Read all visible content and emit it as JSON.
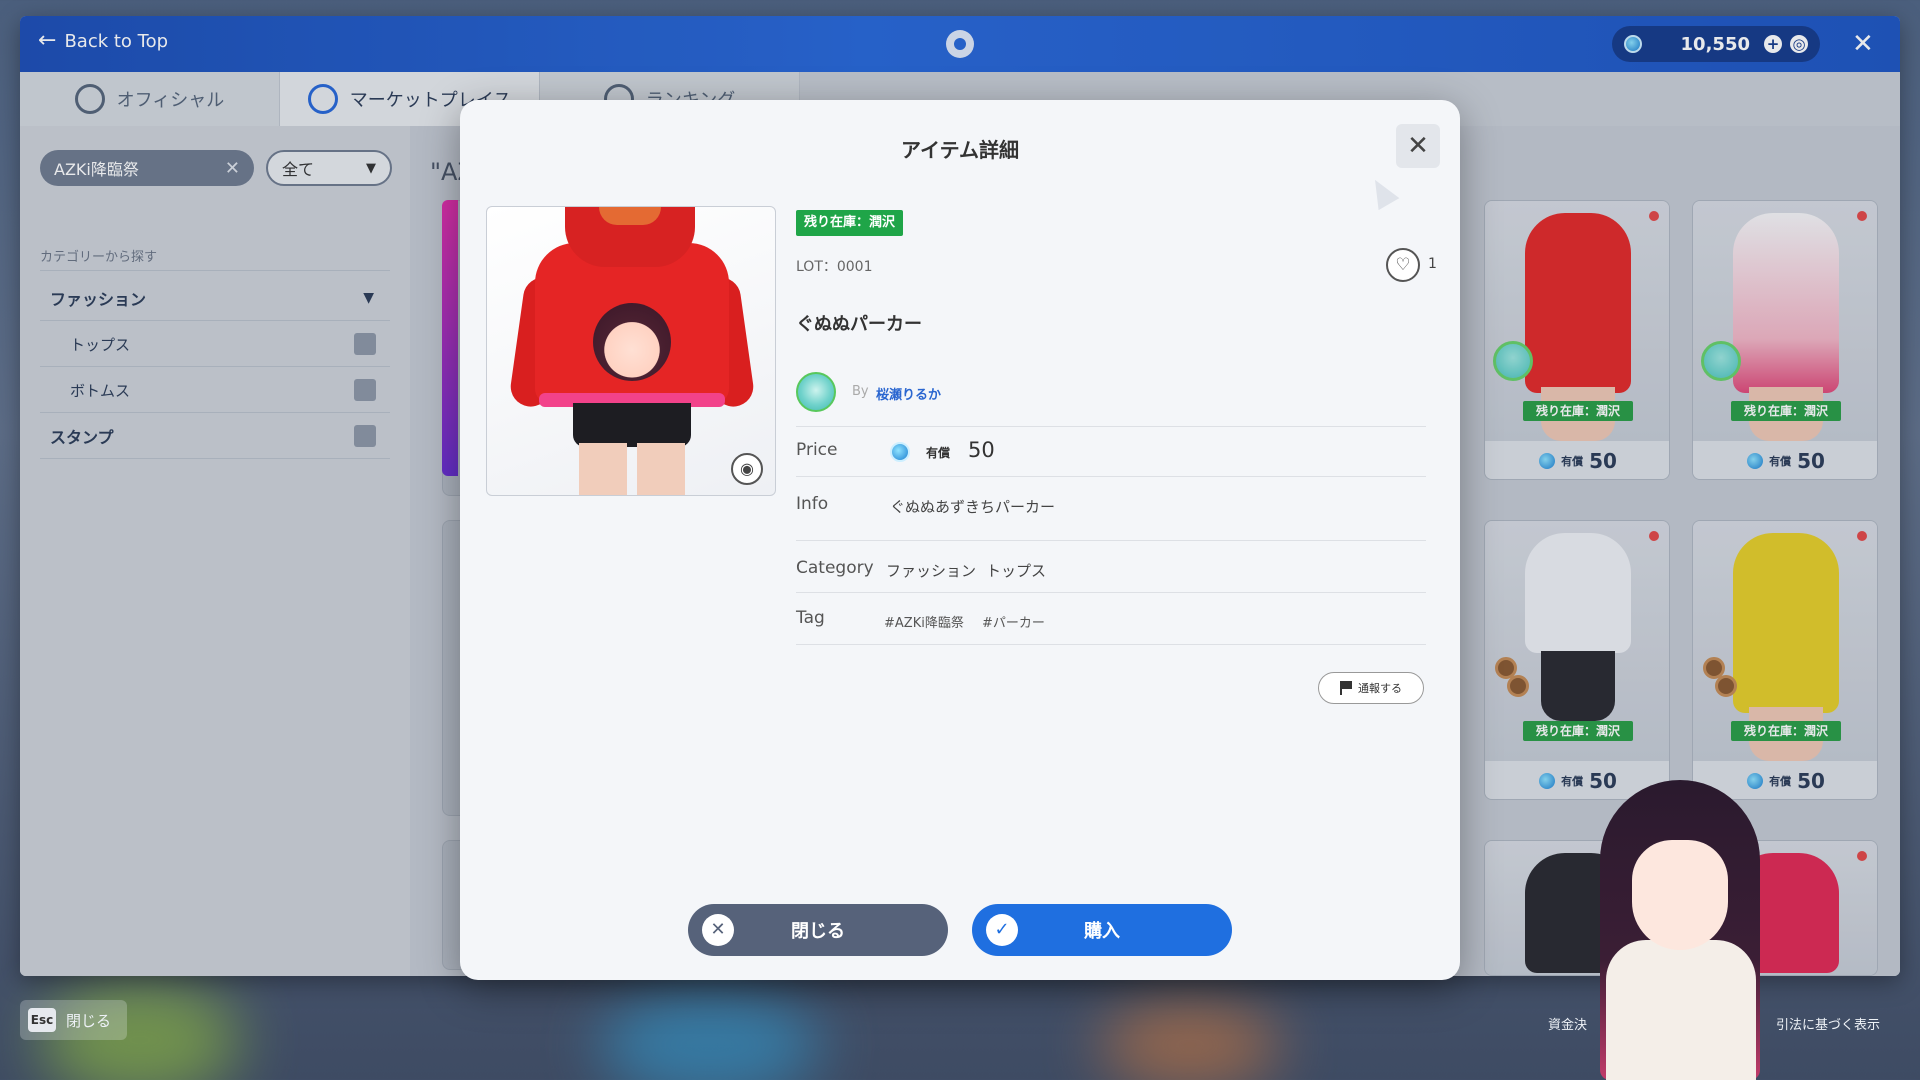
{
  "app": {
    "back_label": "Back to Top",
    "currency_value": "10,550",
    "tabs": [
      {
        "label": "オフィシャル"
      },
      {
        "label": "マーケットプレイス"
      },
      {
        "label": "ランキング"
      }
    ]
  },
  "sidebar": {
    "filter_chip": "AZKi降臨祭",
    "filter_select": "全て",
    "category_heading": "カテゴリーから探す",
    "categories": [
      {
        "label": "ファッション"
      },
      {
        "label": "トップス"
      },
      {
        "label": "ボトムス"
      },
      {
        "label": "スタンプ"
      }
    ]
  },
  "search_label": "\"AZ",
  "grid": {
    "cards": [
      {
        "stock": "残り在庫：潤沢",
        "price_type": "有償",
        "price": "50",
        "color": "#e32a2a"
      },
      {
        "stock": "残り在庫：潤沢",
        "price_type": "有償",
        "price": "50",
        "color": "#f2b6c6"
      },
      {
        "stock": "残り在庫：潤沢",
        "price_type": "有償",
        "price": "50",
        "color": "#eef0f4"
      },
      {
        "stock": "残り在庫：潤沢",
        "price_type": "有償",
        "price": "50",
        "color": "#e6cf2a"
      }
    ]
  },
  "modal": {
    "title": "アイテム詳細",
    "stock_tag": "残り在庫：潤沢",
    "lot": "LOT：0001",
    "like_count": "1",
    "item_name": "ぐぬぬパーカー",
    "by_label": "By",
    "creator_name": "桜瀬りるか",
    "price_label": "Price",
    "price_type": "有償",
    "price_value": "50",
    "info_label": "Info",
    "info_value": "ぐぬぬあずきちパーカー",
    "category_label": "Category",
    "category_values": [
      "ファッション",
      "トップス"
    ],
    "tag_label": "Tag",
    "tags": [
      "#AZKi降臨祭",
      "#パーカー"
    ],
    "report_label": "通報する",
    "close_button": "閉じる",
    "buy_button": "購入"
  },
  "footer": {
    "esc_key": "Esc",
    "esc_label": "閉じる",
    "funds_link": "資金決",
    "law_link": "引法に基づく表示"
  },
  "colors": {
    "accent": "#1f6fe0",
    "stock_green": "#1fa548",
    "topbar": "#2868d8"
  }
}
